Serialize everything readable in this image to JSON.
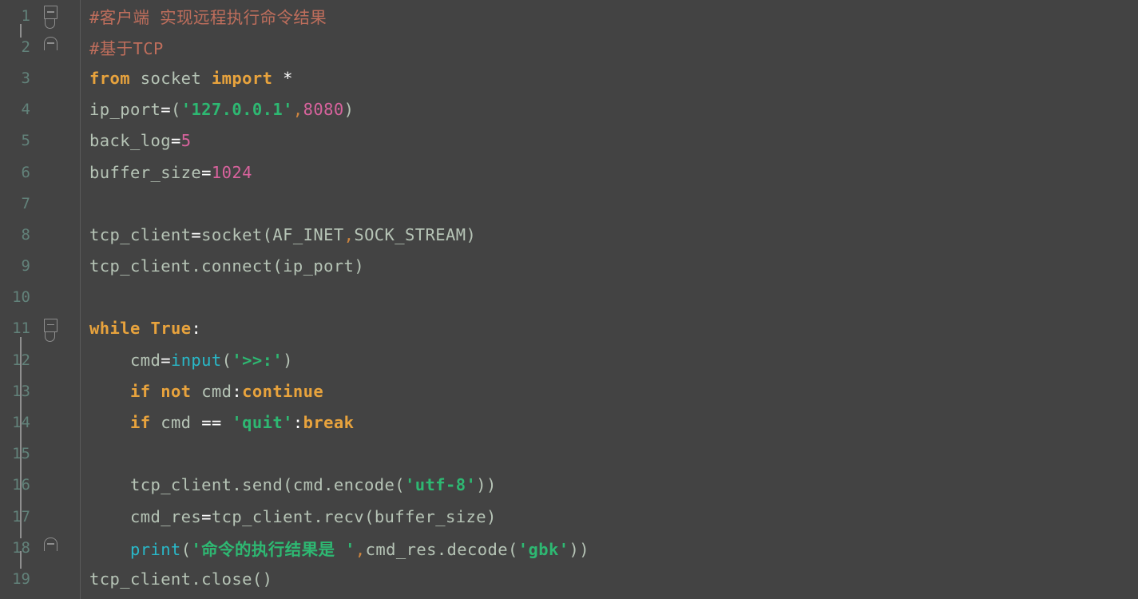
{
  "editor": {
    "language": "Python",
    "background_color": "#434343",
    "gutter_separator_color": "#5a5a5a",
    "line_number_color": "#62827a",
    "default_text_color": "#b6c4b6",
    "syntax_colors": {
      "comment": "#bf6e5c",
      "keyword": "#e8a33d",
      "builtin": "#29b8c8",
      "string": "#2eb872",
      "number": "#d8639d",
      "operator": "#ffffff",
      "comma": "#cd853f",
      "identifier": "#b6c4b6"
    }
  },
  "lines": [
    {
      "number": "1",
      "fold": "start",
      "tokens": [
        {
          "cls": "t-comment",
          "text": "#客户端 实现远程执行命令结果"
        }
      ]
    },
    {
      "number": "2",
      "fold": "end",
      "tokens": [
        {
          "cls": "t-comment",
          "text": "#基于TCP"
        }
      ]
    },
    {
      "number": "3",
      "fold": "none",
      "tokens": [
        {
          "cls": "t-kw",
          "text": "from"
        },
        {
          "cls": "t-plain",
          "text": " "
        },
        {
          "cls": "t-ident",
          "text": "socket"
        },
        {
          "cls": "t-plain",
          "text": " "
        },
        {
          "cls": "t-kw",
          "text": "import"
        },
        {
          "cls": "t-plain",
          "text": " "
        },
        {
          "cls": "t-op",
          "text": "*"
        }
      ]
    },
    {
      "number": "4",
      "fold": "none",
      "tokens": [
        {
          "cls": "t-ident",
          "text": "ip_port"
        },
        {
          "cls": "t-op",
          "text": "="
        },
        {
          "cls": "t-punc",
          "text": "("
        },
        {
          "cls": "t-str",
          "text": "'127.0.0.1'"
        },
        {
          "cls": "t-comma",
          "text": ","
        },
        {
          "cls": "t-num",
          "text": "8080"
        },
        {
          "cls": "t-punc",
          "text": ")"
        }
      ]
    },
    {
      "number": "5",
      "fold": "none",
      "tokens": [
        {
          "cls": "t-ident",
          "text": "back_log"
        },
        {
          "cls": "t-op",
          "text": "="
        },
        {
          "cls": "t-num",
          "text": "5"
        }
      ]
    },
    {
      "number": "6",
      "fold": "none",
      "tokens": [
        {
          "cls": "t-ident",
          "text": "buffer_size"
        },
        {
          "cls": "t-op",
          "text": "="
        },
        {
          "cls": "t-num",
          "text": "1024"
        }
      ]
    },
    {
      "number": "7",
      "fold": "none",
      "tokens": []
    },
    {
      "number": "8",
      "fold": "none",
      "tokens": [
        {
          "cls": "t-ident",
          "text": "tcp_client"
        },
        {
          "cls": "t-op",
          "text": "="
        },
        {
          "cls": "t-ident",
          "text": "socket"
        },
        {
          "cls": "t-punc",
          "text": "("
        },
        {
          "cls": "t-ident",
          "text": "AF_INET"
        },
        {
          "cls": "t-comma",
          "text": ","
        },
        {
          "cls": "t-ident",
          "text": "SOCK_STREAM"
        },
        {
          "cls": "t-punc",
          "text": ")"
        }
      ]
    },
    {
      "number": "9",
      "fold": "none",
      "tokens": [
        {
          "cls": "t-ident",
          "text": "tcp_client.connect"
        },
        {
          "cls": "t-punc",
          "text": "("
        },
        {
          "cls": "t-ident",
          "text": "ip_port"
        },
        {
          "cls": "t-punc",
          "text": ")"
        }
      ]
    },
    {
      "number": "10",
      "fold": "none",
      "tokens": []
    },
    {
      "number": "11",
      "fold": "start",
      "tokens": [
        {
          "cls": "t-kw",
          "text": "while"
        },
        {
          "cls": "t-plain",
          "text": " "
        },
        {
          "cls": "t-kw",
          "text": "True"
        },
        {
          "cls": "t-op",
          "text": ":"
        }
      ]
    },
    {
      "number": "12",
      "fold": "none",
      "tokens": [
        {
          "cls": "t-plain",
          "text": "    "
        },
        {
          "cls": "t-ident",
          "text": "cmd"
        },
        {
          "cls": "t-op",
          "text": "="
        },
        {
          "cls": "t-builtin",
          "text": "input"
        },
        {
          "cls": "t-punc",
          "text": "("
        },
        {
          "cls": "t-str",
          "text": "'>>:'"
        },
        {
          "cls": "t-punc",
          "text": ")"
        }
      ]
    },
    {
      "number": "13",
      "fold": "none",
      "tokens": [
        {
          "cls": "t-plain",
          "text": "    "
        },
        {
          "cls": "t-kw",
          "text": "if"
        },
        {
          "cls": "t-plain",
          "text": " "
        },
        {
          "cls": "t-kw",
          "text": "not"
        },
        {
          "cls": "t-plain",
          "text": " "
        },
        {
          "cls": "t-ident",
          "text": "cmd"
        },
        {
          "cls": "t-op",
          "text": ":"
        },
        {
          "cls": "t-kw",
          "text": "continue"
        }
      ]
    },
    {
      "number": "14",
      "fold": "none",
      "tokens": [
        {
          "cls": "t-plain",
          "text": "    "
        },
        {
          "cls": "t-kw",
          "text": "if"
        },
        {
          "cls": "t-plain",
          "text": " "
        },
        {
          "cls": "t-ident",
          "text": "cmd"
        },
        {
          "cls": "t-plain",
          "text": " "
        },
        {
          "cls": "t-op",
          "text": "=="
        },
        {
          "cls": "t-plain",
          "text": " "
        },
        {
          "cls": "t-str",
          "text": "'quit'"
        },
        {
          "cls": "t-op",
          "text": ":"
        },
        {
          "cls": "t-kw",
          "text": "break"
        }
      ]
    },
    {
      "number": "15",
      "fold": "none",
      "tokens": []
    },
    {
      "number": "16",
      "fold": "none",
      "tokens": [
        {
          "cls": "t-plain",
          "text": "    "
        },
        {
          "cls": "t-ident",
          "text": "tcp_client.send"
        },
        {
          "cls": "t-punc",
          "text": "("
        },
        {
          "cls": "t-ident",
          "text": "cmd.encode"
        },
        {
          "cls": "t-punc",
          "text": "("
        },
        {
          "cls": "t-str",
          "text": "'utf-8'"
        },
        {
          "cls": "t-punc",
          "text": "))"
        }
      ]
    },
    {
      "number": "17",
      "fold": "none",
      "tokens": [
        {
          "cls": "t-plain",
          "text": "    "
        },
        {
          "cls": "t-ident",
          "text": "cmd_res"
        },
        {
          "cls": "t-op",
          "text": "="
        },
        {
          "cls": "t-ident",
          "text": "tcp_client.recv"
        },
        {
          "cls": "t-punc",
          "text": "("
        },
        {
          "cls": "t-ident",
          "text": "buffer_size"
        },
        {
          "cls": "t-punc",
          "text": ")"
        }
      ]
    },
    {
      "number": "18",
      "fold": "end",
      "tokens": [
        {
          "cls": "t-plain",
          "text": "    "
        },
        {
          "cls": "t-builtin",
          "text": "print"
        },
        {
          "cls": "t-punc",
          "text": "("
        },
        {
          "cls": "t-str",
          "text": "'命令的执行结果是 '"
        },
        {
          "cls": "t-comma",
          "text": ","
        },
        {
          "cls": "t-ident",
          "text": "cmd_res.decode"
        },
        {
          "cls": "t-punc",
          "text": "("
        },
        {
          "cls": "t-str",
          "text": "'gbk'"
        },
        {
          "cls": "t-punc",
          "text": "))"
        }
      ]
    },
    {
      "number": "19",
      "fold": "none",
      "tokens": [
        {
          "cls": "t-ident",
          "text": "tcp_client.close"
        },
        {
          "cls": "t-punc",
          "text": "()"
        }
      ]
    }
  ]
}
